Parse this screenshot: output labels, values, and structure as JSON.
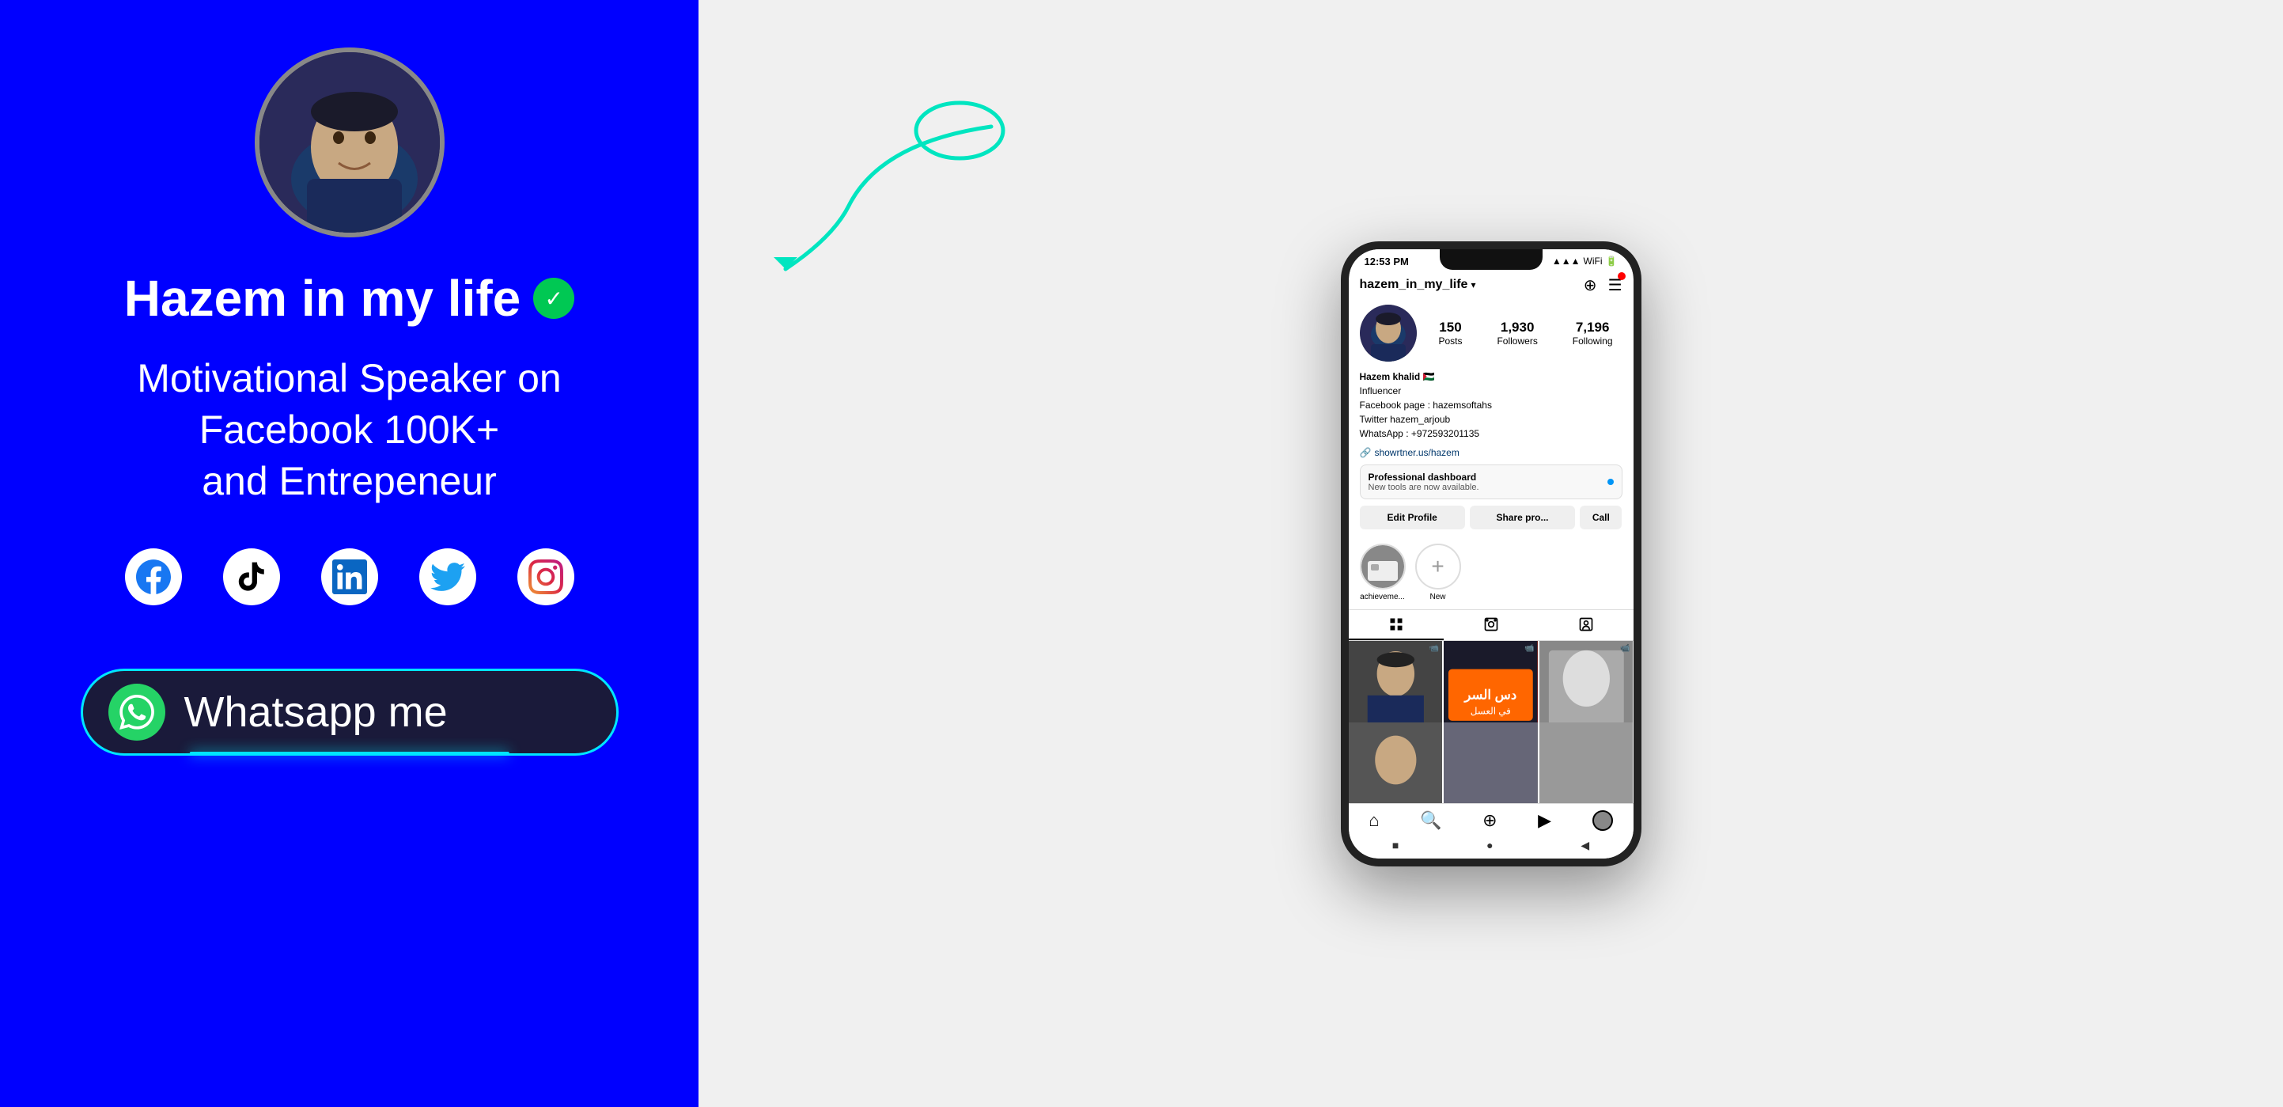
{
  "left": {
    "name": "Hazem in my life",
    "verified": "✓",
    "tagline": "Motivational Speaker on Facebook 100K+\nand Entrepeneur",
    "whatsapp_label": "Whatsapp me",
    "social": [
      "facebook",
      "tiktok",
      "linkedin",
      "twitter",
      "instagram"
    ]
  },
  "phone": {
    "status_time": "12:53 PM",
    "username": "hazem_in_my_life",
    "stats": {
      "posts": "150",
      "posts_label": "Posts",
      "followers": "1,930",
      "followers_label": "Followers",
      "following": "7,196",
      "following_label": "Following"
    },
    "bio_name": "Hazem khalid 🇵🇸",
    "bio_title": "Influencer",
    "bio_facebook": "Facebook page : hazemsoftahs",
    "bio_twitter": "Twitter hazem_arjoub",
    "bio_whatsapp": "WhatsApp : +972593201135",
    "bio_link": "showrtner.us/hazem",
    "dashboard_title": "Professional dashboard",
    "dashboard_sub": "New tools are now available.",
    "btn_edit": "Edit Profile",
    "btn_share": "Share pro...",
    "btn_call": "Call",
    "story_highlight": "achieveme...",
    "story_new": "New",
    "nav": {
      "home": "⌂",
      "search": "🔍",
      "plus": "⊕",
      "reels": "▶",
      "profile": "👤"
    },
    "android_back": "■",
    "android_home": "●",
    "android_recent": "◀"
  }
}
